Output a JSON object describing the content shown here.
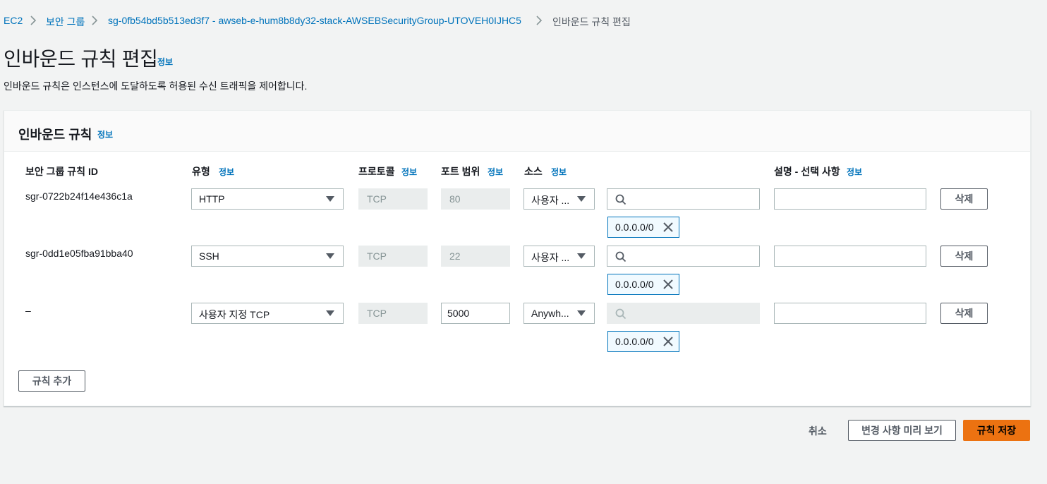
{
  "breadcrumb": {
    "items": [
      "EC2",
      "보안 그룹",
      "sg-0fb54bd5b513ed3f7 - awseb-e-hum8b8dy32-stack-AWSEBSecurityGroup-UTOVEH0IJHC5"
    ],
    "current": "인바운드 규칙 편집"
  },
  "page": {
    "title": "인바운드 규칙 편집",
    "info_label": "정보",
    "description": "인바운드 규칙은 인스턴스에 도달하도록 허용된 수신 트래픽을 제어합니다."
  },
  "panel": {
    "title": "인바운드 규칙",
    "info_label": "정보",
    "columns": {
      "rule_id": "보안 그룹 규칙 ID",
      "type": "유형",
      "protocol": "프로토콜",
      "port_range": "포트 범위",
      "source": "소스",
      "description": "설명 - 선택 사항",
      "info_label": "정보"
    },
    "rows": [
      {
        "rule_id": "sgr-0722b24f14e436c1a",
        "type": "HTTP",
        "protocol": "TCP",
        "port": "80",
        "source": "사용자 ...",
        "cidr": "0.0.0.0/0",
        "description": "",
        "delete_label": "삭제"
      },
      {
        "rule_id": "sgr-0dd1e05fba91bba40",
        "type": "SSH",
        "protocol": "TCP",
        "port": "22",
        "source": "사용자 ...",
        "cidr": "0.0.0.0/0",
        "description": "",
        "delete_label": "삭제"
      },
      {
        "rule_id": "–",
        "type": "사용자 지정 TCP",
        "protocol": "TCP",
        "port": "5000",
        "source": "Anywh...",
        "cidr": "0.0.0.0/0",
        "description": "",
        "delete_label": "삭제"
      }
    ],
    "add_rule_label": "규칙 추가"
  },
  "footer": {
    "cancel_label": "취소",
    "preview_label": "변경 사항 미리 보기",
    "save_label": "규칙 저장"
  },
  "colors": {
    "link": "#0073bb",
    "primary": "#ec7211",
    "background": "#f2f3f3"
  }
}
